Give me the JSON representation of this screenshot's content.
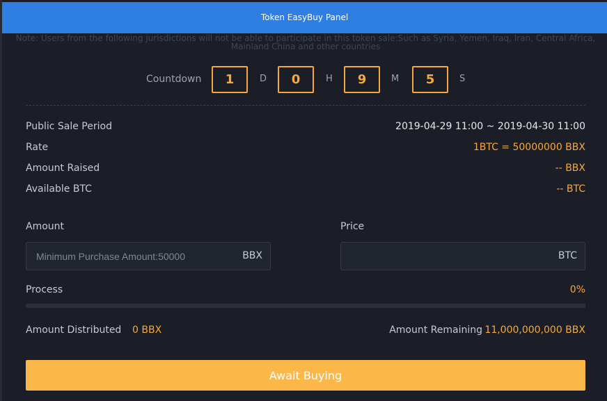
{
  "header": {
    "title": "Token EasyBuy Panel"
  },
  "notice": "Note: Users from the following jurisdictions will not be able to participate in this token sale:Such as Syria, Yemen, Iraq, Iran, Central Africa, Mainland China and other countries",
  "countdown": {
    "label": "Countdown",
    "days": "1",
    "days_unit": "D",
    "hours": "0",
    "hours_unit": "H",
    "minutes": "9",
    "minutes_unit": "M",
    "seconds": "5",
    "seconds_unit": "S"
  },
  "info": {
    "sale_period_label": "Public Sale Period",
    "sale_period_value": "2019-04-29 11:00 ~ 2019-04-30 11:00",
    "rate_label": "Rate",
    "rate_value": "1BTC = 50000000 BBX",
    "raised_label": "Amount Raised",
    "raised_value": "-- BBX",
    "available_label": "Available BTC",
    "available_value": "-- BTC"
  },
  "form": {
    "amount_label": "Amount",
    "amount_placeholder": "Minimum Purchase Amount:50000",
    "amount_unit": "BBX",
    "price_label": "Price",
    "price_unit": "BTC"
  },
  "process": {
    "label": "Process",
    "value_text": "0%",
    "fraction": 0
  },
  "distribution": {
    "distributed_label": "Amount Distributed",
    "distributed_value": "0 BBX",
    "remaining_label": "Amount Remaining",
    "remaining_value": "11,000,000,000 BBX"
  },
  "button": {
    "label": "Await Buying"
  },
  "colors": {
    "accent": "#f7a83a",
    "header": "#2f7ee4",
    "panel": "#1b1e27"
  }
}
